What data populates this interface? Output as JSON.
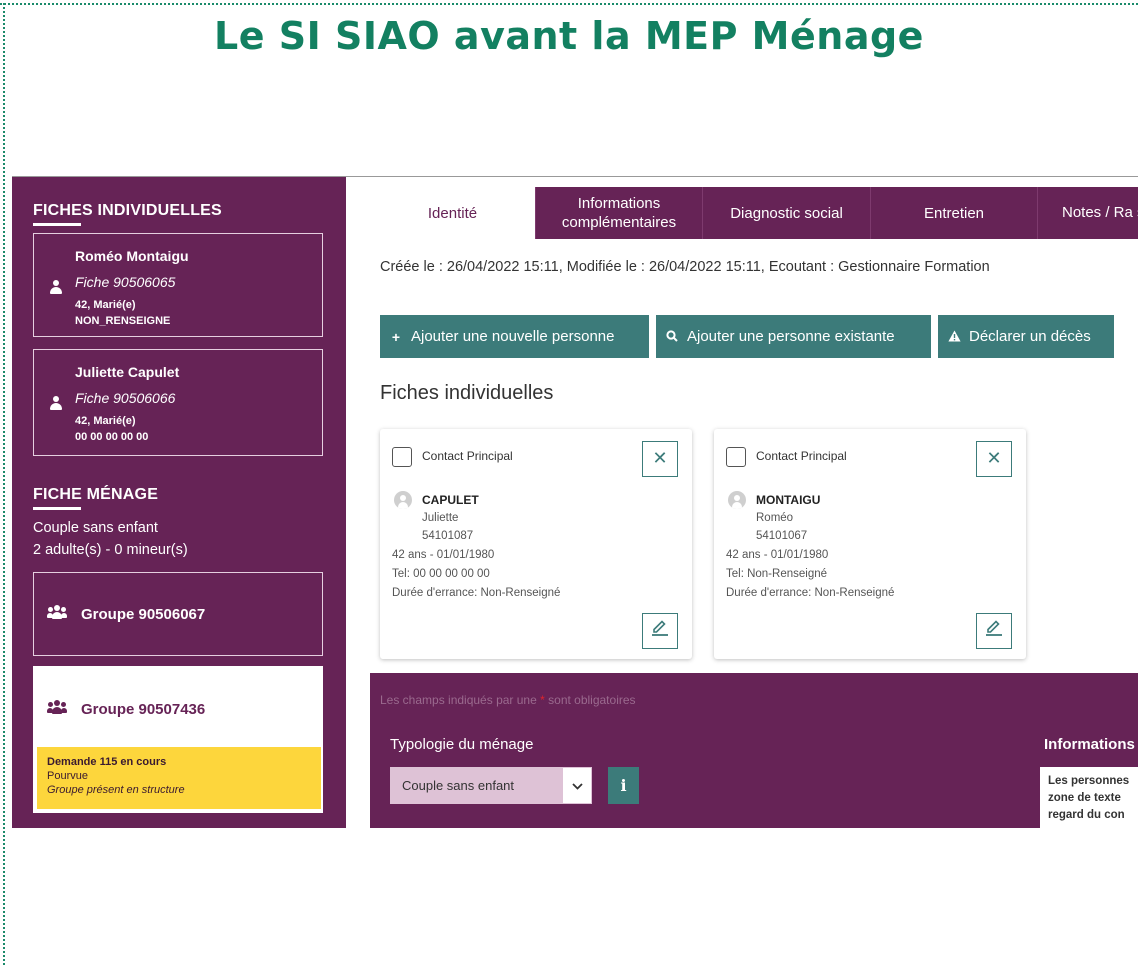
{
  "slide": {
    "title": "Le SI SIAO avant la MEP Ménage"
  },
  "sidebar": {
    "individual_heading": "FICHES INDIVIDUELLES",
    "persons": [
      {
        "name": "Roméo Montaigu",
        "fiche": "Fiche 90506065",
        "age_status": "42, Marié(e)",
        "phone": "NON_RENSEIGNE"
      },
      {
        "name": "Juliette Capulet",
        "fiche": "Fiche 90506066",
        "age_status": "42, Marié(e)",
        "phone": "00 00 00 00 00"
      }
    ],
    "household_heading": "FICHE MÉNAGE",
    "household_type": "Couple sans enfant",
    "household_count": "2 adulte(s) - 0 mineur(s)",
    "groups": [
      {
        "label": "Groupe 90506067"
      },
      {
        "label": "Groupe 90507436",
        "demande_title": "Demande 115 en cours",
        "demande_status": "Pourvue",
        "demande_note": "Groupe présent en structure"
      }
    ]
  },
  "tabs": [
    "Identité",
    "Informations complémentaires",
    "Diagnostic social",
    "Entretien",
    "Notes / Ra sociа"
  ],
  "meta_line": "Créée le : 26/04/2022 15:11, Modifiée le : 26/04/2022 15:11, Ecoutant : Gestionnaire Formation",
  "actions": {
    "add_new": "Ajouter une nouvelle personne",
    "add_existing": "Ajouter une personne existante",
    "declare_death": "Déclarer un décès"
  },
  "section_title": "Fiches individuelles",
  "cards": [
    {
      "contact_label": "Contact Principal",
      "last_name": "CAPULET",
      "first_name": "Juliette",
      "id": "54101087",
      "age_dob": "42 ans - 01/01/1980",
      "tel": "Tel: 00 00 00 00 00",
      "errance": "Durée d'errance: Non-Renseigné"
    },
    {
      "contact_label": "Contact Principal",
      "last_name": "MONTAIGU",
      "first_name": "Roméo",
      "id": "54101067",
      "age_dob": "42 ans - 01/01/1980",
      "tel": "Tel: Non-Renseigné",
      "errance": "Durée d'errance: Non-Renseigné"
    }
  ],
  "form": {
    "required_note_before": "Les champs indiqués par une",
    "required_star": "*",
    "required_note_after": "sont obligatoires",
    "typology_label": "Typologie du ménage",
    "typology_value": "Couple sans enfant",
    "info_label": "Informations",
    "info_lines": [
      "Les personnes",
      "zone de texte",
      "regard du con"
    ]
  },
  "colors": {
    "brand_purple": "#662356",
    "teal": "#3c7b7a",
    "title_green": "#138061",
    "alert_yellow": "#fdd63c"
  }
}
